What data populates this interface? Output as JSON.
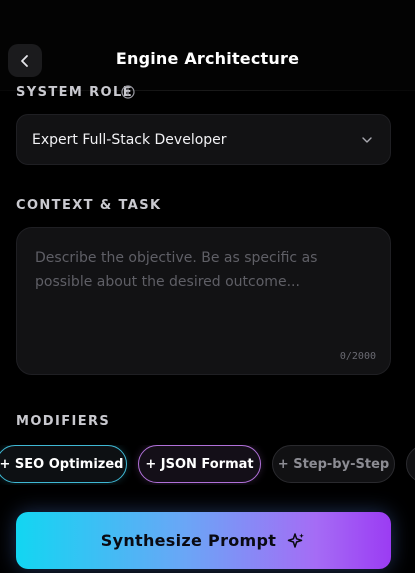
{
  "header": {
    "title": "Engine Architecture",
    "back_icon": "chevron-left-icon"
  },
  "system_role": {
    "label": "SYSTEM ROLE",
    "info_icon": "info-icon",
    "selected_value": "Expert Full-Stack Developer"
  },
  "context": {
    "label": "CONTEXT & TASK",
    "placeholder": "Describe the objective. Be as specific as possible about the desired outcome...",
    "counter": "0/2000"
  },
  "modifiers": {
    "label": "MODIFIERS",
    "chips": [
      {
        "label": "+ SEO Optimized",
        "accent": "#3fb8d4"
      },
      {
        "label": "+ JSON Format",
        "accent": "#b070d8"
      },
      {
        "label": "+ Step-by-Step",
        "accent": "#2a2a2e"
      }
    ]
  },
  "cta": {
    "label": "Synthesize Prompt",
    "icon": "sparkle-icon",
    "gradient": [
      "#12d6f2",
      "#9b3cf3"
    ]
  },
  "colors": {
    "background": "#000000",
    "surface": "#121214",
    "label": "#c9c9cf"
  }
}
